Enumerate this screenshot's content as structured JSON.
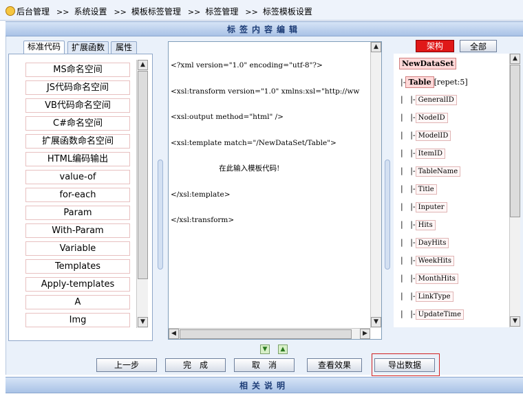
{
  "breadcrumb": {
    "items": [
      "后台管理",
      "系统设置",
      "模板标签管理",
      "标签管理",
      "标签模板设置"
    ],
    "separator": ">>"
  },
  "section_title": "标签内容编辑",
  "footer_title": "相关说明",
  "tabs": [
    "标准代码",
    "扩展函数",
    "属性"
  ],
  "left_list": [
    "MS命名空间",
    "JS代码命名空间",
    "VB代码命名空间",
    "C#命名空间",
    "扩展函数命名空间",
    "HTML编码输出",
    "value-of",
    "for-each",
    "Param",
    "With-Param",
    "Variable",
    "Templates",
    "Apply-templates",
    "A",
    "Img"
  ],
  "editor": {
    "lines": [
      "<?xml version=\"1.0\" encoding=\"utf-8\"?>",
      "<xsl:transform version=\"1.0\" xmlns:xsl=\"http://ww",
      "<xsl:output method=\"html\" />",
      "<xsl:template match=\"/NewDataSet/Table\">",
      "                     在此输入模板代码!",
      "</xsl:template>",
      "</xsl:transform>"
    ]
  },
  "right_buttons": {
    "framework": "架构",
    "all": "全部"
  },
  "tree": {
    "root": "NewDataSet",
    "table": "Table",
    "repeat": "[repet:5]",
    "fields": [
      "GeneralID",
      "NodeID",
      "ModelID",
      "ItemID",
      "TableName",
      "Title",
      "Inputer",
      "Hits",
      "DayHits",
      "WeekHits",
      "MonthHits",
      "LinkType",
      "UpdateTime"
    ]
  },
  "buttons": {
    "prev": "上一步",
    "done": "完　成",
    "cancel": "取　消",
    "preview": "查看效果",
    "export": "导出数据"
  },
  "colors": {
    "title_text": "#1d3d77",
    "framework_button": "#e01818",
    "highlight_frame": "#d02020"
  }
}
